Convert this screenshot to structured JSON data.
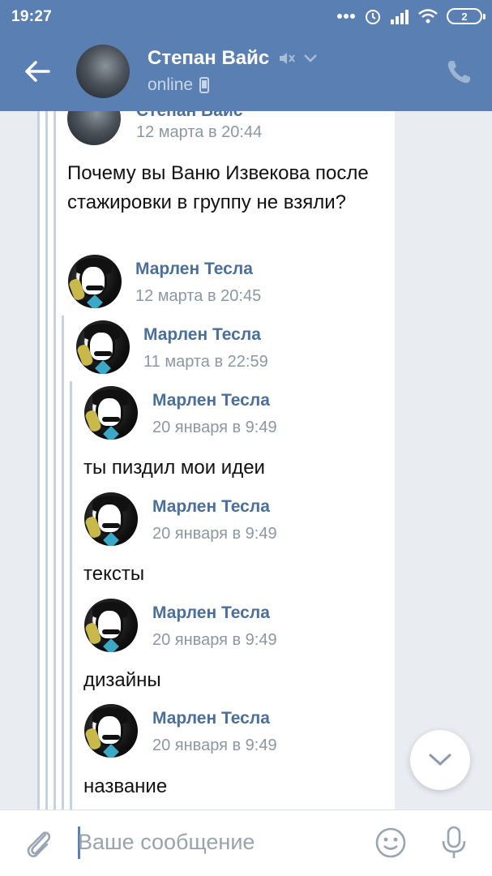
{
  "status_bar": {
    "time": "19:27",
    "battery": "2"
  },
  "header": {
    "contact_name": "Степан Вайс",
    "status": "online"
  },
  "thread": {
    "cut_author": "Степан Вайс",
    "root_date": "12 марта в 20:44",
    "root_text": "Почему вы Ваню Извекова после стажировки в группу не взяли?",
    "items": [
      {
        "author": "Марлен Тесла",
        "date": "12 марта в 20:45"
      },
      {
        "author": "Марлен Тесла",
        "date": "11 марта в 22:59"
      },
      {
        "author": "Марлен Тесла",
        "date": "20 января в 9:49",
        "text": "ты пиздил мои идеи"
      },
      {
        "author": "Марлен Тесла",
        "date": "20 января в 9:49",
        "text": "тексты"
      },
      {
        "author": "Марлен Тесла",
        "date": "20 января в 9:49",
        "text": "дизайны"
      },
      {
        "author": "Марлен Тесла",
        "date": "20 января в 9:49",
        "text": "название"
      }
    ]
  },
  "composer": {
    "placeholder": "Ваше сообщение"
  },
  "icons": {
    "back": "arrow-left-icon",
    "mute": "mute-icon",
    "dropdown": "chevron-down-icon",
    "mobile": "mobile-icon",
    "call": "phone-icon",
    "scroll_down": "chevron-down-icon",
    "attach": "paperclip-icon",
    "emoji": "smile-icon",
    "voice": "mic-icon"
  },
  "colors": {
    "header": "#5a7fb2",
    "name": "#4a6f9a",
    "date": "#8c97a3"
  }
}
